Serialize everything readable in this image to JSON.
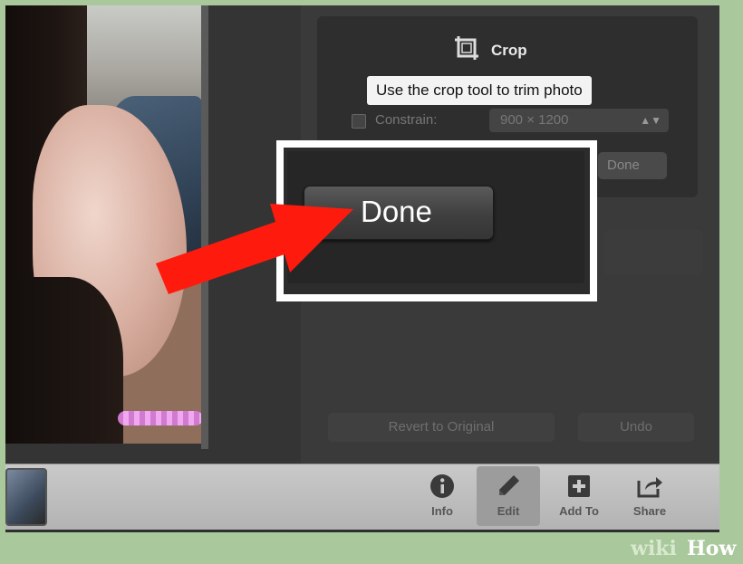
{
  "crop_panel": {
    "title": "Crop",
    "tooltip": "Use the crop tool to trim photo",
    "constrain_label": "Constrain:",
    "size_value": "900 × 1200",
    "done_partial": "Done",
    "revert_label": "Revert to Original",
    "undo_label": "Undo"
  },
  "zoom_overlay": {
    "done_label": "Done",
    "highlight_color": "#ffffff",
    "arrow_color": "#ff1a0e"
  },
  "toolbar": {
    "items": [
      {
        "label": "Info",
        "icon": "info-icon"
      },
      {
        "label": "Edit",
        "icon": "pencil-icon",
        "selected": true
      },
      {
        "label": "Add To",
        "icon": "plus-square-icon"
      },
      {
        "label": "Share",
        "icon": "share-icon"
      }
    ]
  },
  "watermark": {
    "wiki": "wiki",
    "how": "How"
  }
}
